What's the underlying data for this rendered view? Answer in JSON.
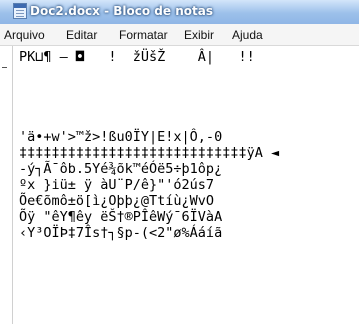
{
  "window": {
    "title": "Doc2.docx - Bloco de notas"
  },
  "menu": [
    "Arquivo",
    "Editar",
    "Formatar",
    "Exibir",
    "Ajuda"
  ],
  "lines": [
    "PK⊔¶ – ◘   !  žÜšŽ    Â|   !!",
    "",
    "",
    "'ä•+w'>™ž>!ßu0ÏY|E!x|Ô,-0",
    "‡‡‡‡‡‡‡‡‡‡‡‡‡‡‡‡‡‡‡‡‡‡‡‡‡‡‡‡ÿA ◄",
    "-ý┐Ã¯ôb.5Yé¾õk™éÓë5÷þ1ôp¿",
    "ºx }iü± ÿ àU¨P/ê}\"'ó2ús7",
    "Õe€õmô±ö[ì¿Oþþ¿@Ttíù¿WvO",
    "Õÿ \"êY¶êy ëŠ†®PÎêWý¯6ÏVàA",
    "‹Y³OÏÞ‡7Îs†┐§p-(<2\"ø%Ááíã"
  ]
}
